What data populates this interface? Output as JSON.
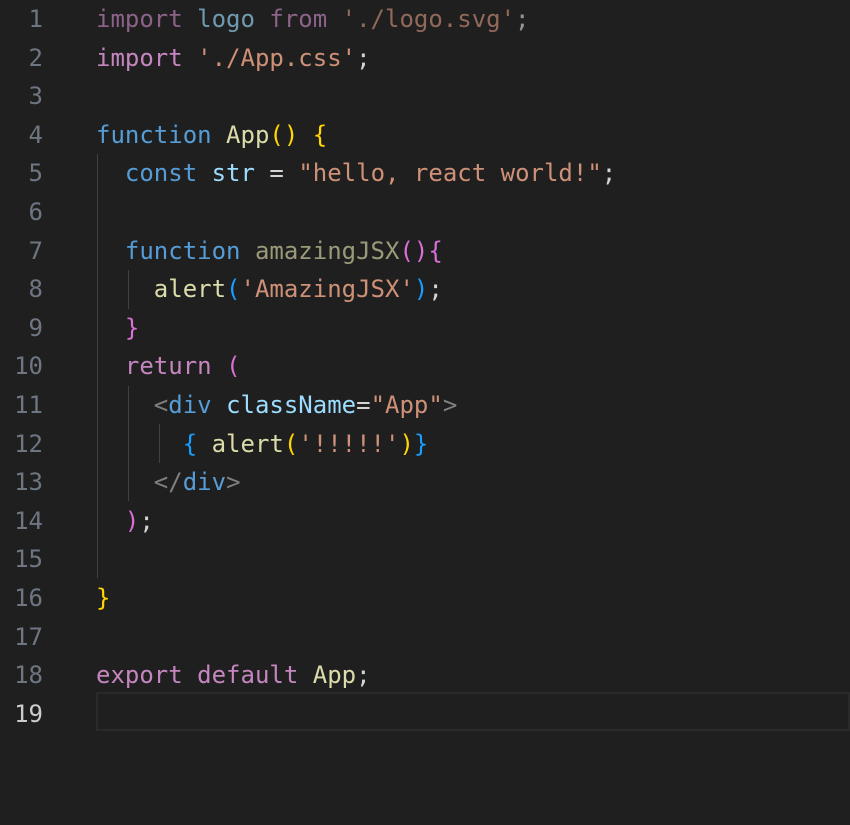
{
  "editor": {
    "active_line": 19,
    "line_numbers": [
      "1",
      "2",
      "3",
      "4",
      "5",
      "6",
      "7",
      "8",
      "9",
      "10",
      "11",
      "12",
      "13",
      "14",
      "15",
      "16",
      "17",
      "18",
      "19"
    ],
    "code": {
      "l1": {
        "kw_import": "import",
        "sp1": " ",
        "id_logo": "logo",
        "sp2": " ",
        "kw_from": "from",
        "sp3": " ",
        "str": "'./logo.svg'",
        "semi": ";"
      },
      "l2": {
        "kw_import": "import",
        "sp1": " ",
        "str": "'./App.css'",
        "semi": ";"
      },
      "l4": {
        "kw_function": "function",
        "sp1": " ",
        "fn": "App",
        "b1": "(",
        "b2": ")",
        "sp2": " ",
        "b3": "{"
      },
      "l5": {
        "indent": "  ",
        "kw_const": "const",
        "sp1": " ",
        "var": "str",
        "op": " = ",
        "str": "\"hello, react world!\"",
        "semi": ";"
      },
      "l7": {
        "indent": "  ",
        "kw_function": "function",
        "sp1": " ",
        "fn": "amazingJSX",
        "b1": "(",
        "b2": ")",
        "b3": "{"
      },
      "l8": {
        "indent": "    ",
        "fn": "alert",
        "b1": "(",
        "str": "'AmazingJSX'",
        "b2": ")",
        "semi": ";"
      },
      "l9": {
        "indent": "  ",
        "b1": "}"
      },
      "l10": {
        "indent": "  ",
        "kw_return": "return",
        "sp1": " ",
        "b1": "("
      },
      "l11": {
        "indent": "    ",
        "lt": "<",
        "tag": "div",
        "sp1": " ",
        "attr": "className",
        "eq": "=",
        "str": "\"App\"",
        "gt": ">"
      },
      "l12": {
        "indent": "      ",
        "b1": "{",
        "sp1": " ",
        "fn": "alert",
        "b2": "(",
        "str": "'!!!!!'",
        "b3": ")",
        "b4": "}"
      },
      "l13": {
        "indent": "    ",
        "lt": "</",
        "tag": "div",
        "gt": ">"
      },
      "l14": {
        "indent": "  ",
        "b1": ")",
        "semi": ";"
      },
      "l16": {
        "b1": "}"
      },
      "l18": {
        "kw_export": "export",
        "sp1": " ",
        "kw_default": "default",
        "sp2": " ",
        "fn": "App",
        "semi": ";"
      }
    }
  }
}
